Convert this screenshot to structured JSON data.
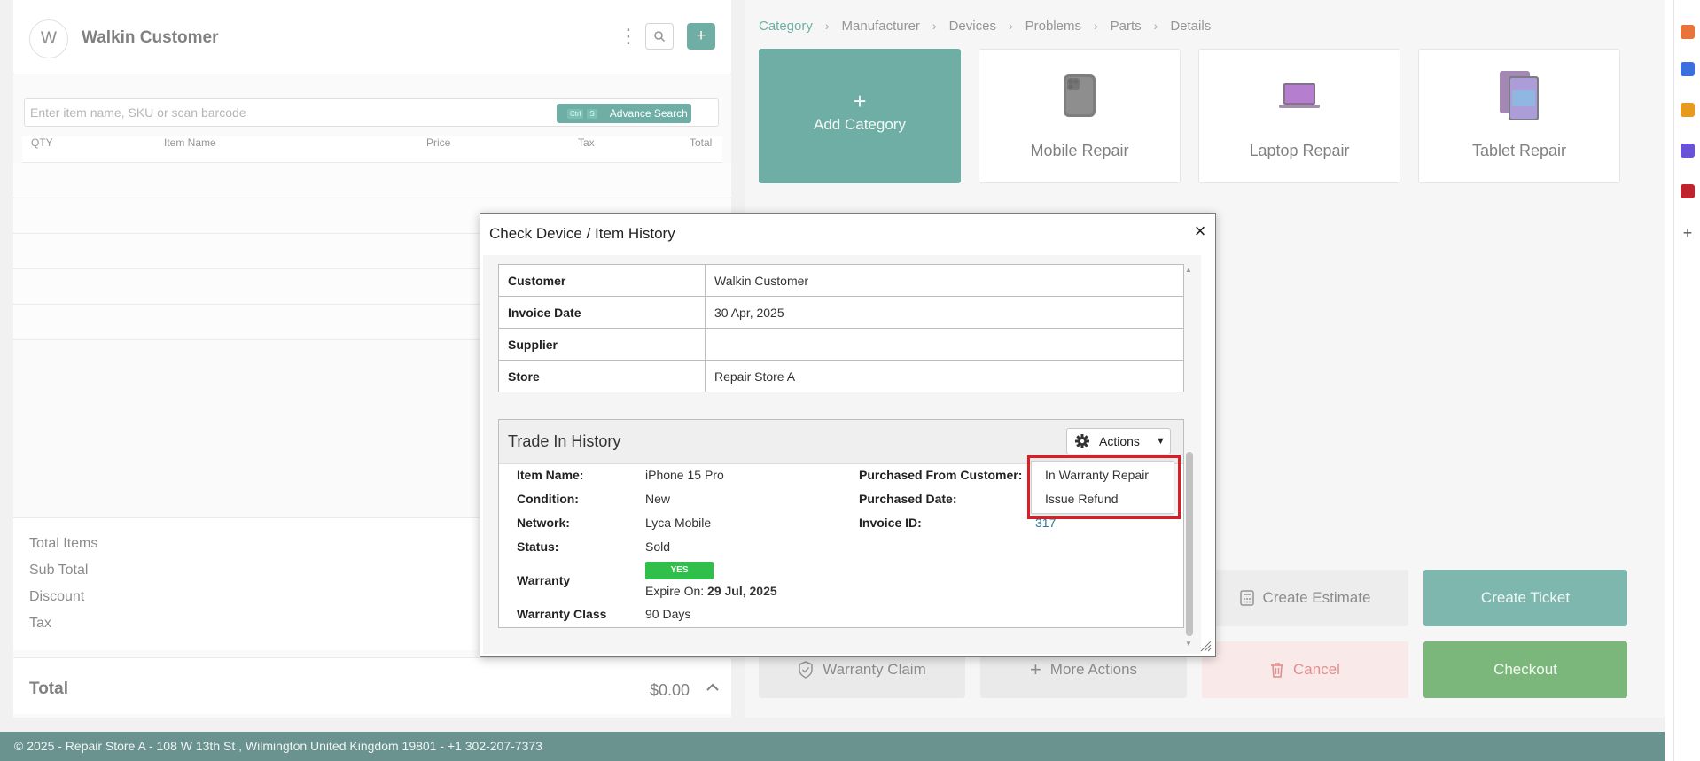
{
  "customer_panel": {
    "avatar_initial": "W",
    "customer_name": "Walkin Customer",
    "icons": [
      "kebab-icon",
      "search-icon",
      "plus-icon"
    ]
  },
  "item_search": {
    "placeholder": "Enter item name, SKU or scan barcode",
    "shortcut_keys": [
      "Ctrl",
      "S"
    ],
    "advance_search_label": "Advance Search"
  },
  "cart": {
    "columns": [
      "QTY",
      "Item Name",
      "Price",
      "Tax",
      "Total"
    ],
    "empty_rows": 5
  },
  "totals": {
    "labels": [
      "Total Items",
      "Sub Total",
      "Discount",
      "Tax"
    ],
    "grand_label": "Total",
    "grand_value": "$0.00"
  },
  "breadcrumb": [
    "Category",
    "Manufacturer",
    "Devices",
    "Problems",
    "Parts",
    "Details"
  ],
  "categories": {
    "add_label": "Add Category",
    "tiles": [
      {
        "label": "Mobile Repair",
        "icon": "phone-icon"
      },
      {
        "label": "Laptop Repair",
        "icon": "laptop-icon"
      },
      {
        "label": "Tablet Repair",
        "icon": "tablet-icon"
      }
    ]
  },
  "actions": {
    "create_estimate": "Create Estimate",
    "create_ticket": "Create Ticket",
    "warranty_claim": "Warranty Claim",
    "more_actions": "More Actions",
    "cancel": "Cancel",
    "checkout": "Checkout"
  },
  "footer_text": "© 2025 - Repair Store A - 108 W 13th St , Wilmington United Kingdom 19801 - +1 302-207-7373",
  "modal": {
    "title": "Check Device / Item History",
    "info_rows": [
      {
        "key": "Customer",
        "value": "Walkin Customer"
      },
      {
        "key": "Invoice Date",
        "value": "30 Apr, 2025"
      },
      {
        "key": "Supplier",
        "value": ""
      },
      {
        "key": "Store",
        "value": "Repair Store A"
      }
    ],
    "trade_in": {
      "title": "Trade In History",
      "actions_label": "Actions",
      "item_name_label": "Item Name:",
      "item_name": "iPhone 15 Pro",
      "condition_label": "Condition:",
      "condition": "New",
      "network_label": "Network:",
      "network": "Lyca Mobile",
      "status_label": "Status:",
      "status": "Sold",
      "warranty_label": "Warranty",
      "warranty_badge": "YES",
      "expire_label": "Expire On:",
      "expire_date": "29 Jul, 2025",
      "warranty_class_label": "Warranty Class",
      "warranty_class": "90 Days",
      "purchased_from_label": "Purchased From Customer:",
      "purchased_date_label": "Purchased Date:",
      "invoice_id_label": "Invoice ID:",
      "invoice_id": "317"
    },
    "actions_menu": [
      "In Warranty Repair",
      "Issue Refund"
    ]
  },
  "colors": {
    "brand_teal": "#187d6c",
    "checkout_green": "#2a8b2a",
    "footer_bg": "#0f4f49",
    "highlight_red": "#d91f26",
    "badge_green": "#2fbf4a"
  }
}
